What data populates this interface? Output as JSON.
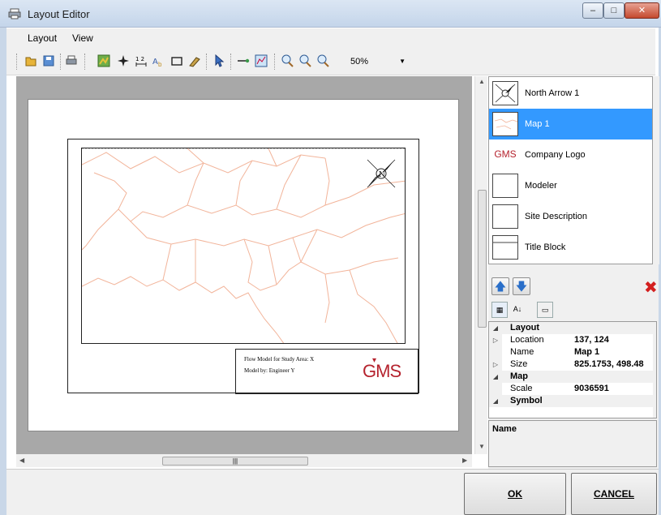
{
  "window": {
    "title": "Layout Editor"
  },
  "menu": [
    "Layout",
    "View"
  ],
  "toolbar": {
    "zoom": "50%"
  },
  "map": {
    "title_block_line1": "Flow Model for Study Area: X",
    "title_block_line2": "Model by: Engineer Y",
    "logo": "GMS"
  },
  "layers": [
    {
      "label": "North Arrow 1",
      "icon": "north-arrow-icon"
    },
    {
      "label": "Map 1",
      "icon": "map-thumb",
      "selected": true
    },
    {
      "label": "Company Logo",
      "icon": "gms-logo-icon"
    },
    {
      "label": "Modeler",
      "icon": "text-box-thumb"
    },
    {
      "label": "Site Description",
      "icon": "text-box-thumb"
    },
    {
      "label": "Title Block",
      "icon": "title-block-thumb"
    }
  ],
  "properties": {
    "cat_layout": "Layout",
    "location_key": "Location",
    "location_val": "137, 124",
    "name_key": "Name",
    "name_val": "Map 1",
    "size_key": "Size",
    "size_val": "825.1753, 498.48",
    "cat_map": "Map",
    "scale_key": "Scale",
    "scale_val": "9036591",
    "cat_symbol": "Symbol"
  },
  "description": {
    "title": "Name"
  },
  "buttons": {
    "ok": "OK",
    "cancel": "CANCEL"
  },
  "colors": {
    "selection": "#3399ff",
    "map_lines": "#f2b49a",
    "logo": "#b5232e",
    "delete": "#d31f1f"
  }
}
